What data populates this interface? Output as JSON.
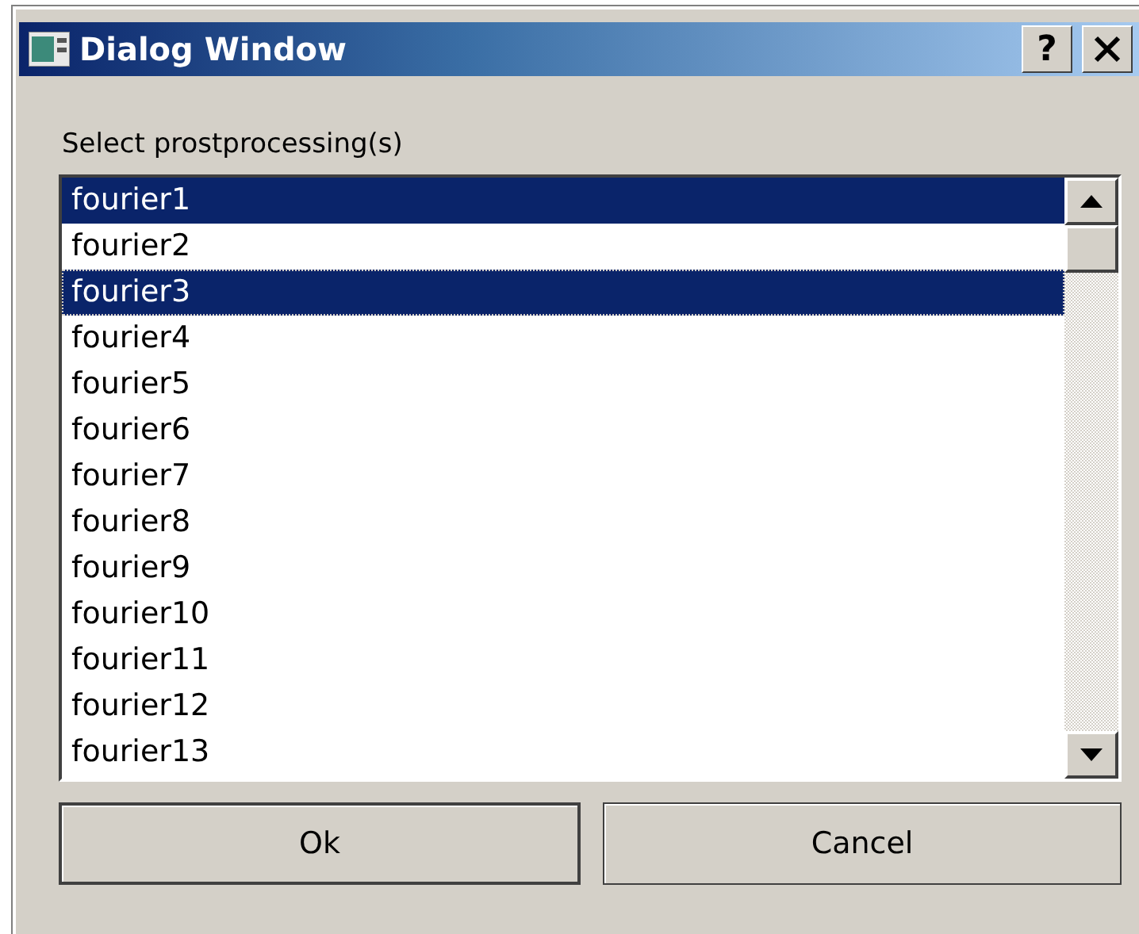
{
  "window": {
    "title": "Dialog Window",
    "title_buttons": [
      "?"
    ]
  },
  "label": "Select prostprocessing(s)",
  "list": {
    "items": [
      {
        "text": "fourier1",
        "selected": true,
        "focused": false
      },
      {
        "text": "fourier2",
        "selected": false,
        "focused": false
      },
      {
        "text": "fourier3",
        "selected": true,
        "focused": true
      },
      {
        "text": "fourier4",
        "selected": false,
        "focused": false
      },
      {
        "text": "fourier5",
        "selected": false,
        "focused": false
      },
      {
        "text": "fourier6",
        "selected": false,
        "focused": false
      },
      {
        "text": "fourier7",
        "selected": false,
        "focused": false
      },
      {
        "text": "fourier8",
        "selected": false,
        "focused": false
      },
      {
        "text": "fourier9",
        "selected": false,
        "focused": false
      },
      {
        "text": "fourier10",
        "selected": false,
        "focused": false
      },
      {
        "text": "fourier11",
        "selected": false,
        "focused": false
      },
      {
        "text": "fourier12",
        "selected": false,
        "focused": false
      },
      {
        "text": "fourier13",
        "selected": false,
        "focused": false
      }
    ]
  },
  "buttons": [
    {
      "label": "Ok",
      "default": true
    },
    {
      "label": "Cancel",
      "default": false
    }
  ]
}
